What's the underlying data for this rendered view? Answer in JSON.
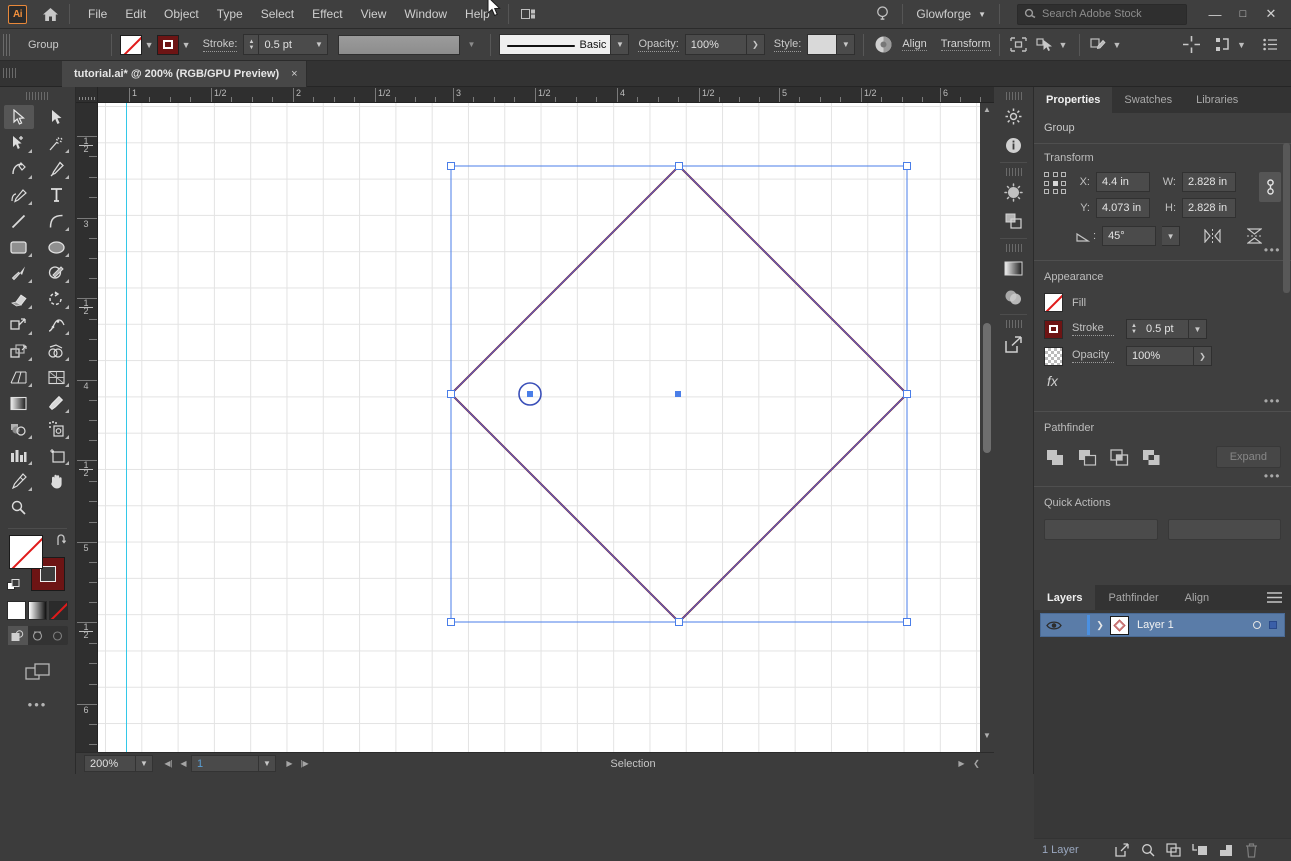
{
  "app": {
    "logo": "Ai",
    "title": "Adobe Illustrator"
  },
  "menubar": {
    "items": [
      "File",
      "Edit",
      "Object",
      "Type",
      "Select",
      "Effect",
      "View",
      "Window",
      "Help"
    ],
    "account": "Glowforge",
    "search_placeholder": "Search Adobe Stock",
    "window_buttons": [
      "minimize",
      "maximize",
      "close"
    ]
  },
  "controlbar": {
    "selection_label": "Group",
    "stroke_label": "Stroke:",
    "stroke_weight": "0.5 pt",
    "brush_label": "Basic",
    "opacity_label": "Opacity:",
    "opacity_value": "100%",
    "style_label": "Style:",
    "align_label": "Align",
    "transform_label": "Transform"
  },
  "tab": {
    "title": "tutorial.ai* @ 200% (RGB/GPU Preview)",
    "close": "×"
  },
  "toolbar": {
    "tools": [
      "selection-tool",
      "direct-selection-tool",
      "magic-wand-tool",
      "lasso-tool",
      "curvature-tool",
      "pen-tool",
      "add-anchor-point-tool",
      "type-tool",
      "line-segment-tool",
      "arc-tool",
      "rectangle-tool",
      "ellipse-tool",
      "paintbrush-tool",
      "shaper-tool",
      "eraser-tool",
      "rotate-tool",
      "scale-tool",
      "width-tool",
      "free-transform-tool",
      "shape-builder-tool",
      "perspective-grid-tool",
      "mesh-tool",
      "gradient-tool",
      "eyedropper-tool",
      "blend-tool",
      "symbol-sprayer-tool",
      "column-graph-tool",
      "artboard-tool",
      "slice-tool",
      "hand-tool",
      "zoom-tool"
    ],
    "active_tool": "selection-tool",
    "fill": "None",
    "stroke": "#6d1414",
    "color_modes": [
      "color",
      "gradient",
      "none"
    ],
    "draw_modes": [
      "draw-normal",
      "draw-behind",
      "draw-inside"
    ],
    "screen_mode": "screen-mode-toggle",
    "more": "•••"
  },
  "rulers": {
    "horizontal": [
      "1",
      "1/2",
      "2",
      "1/2",
      "3",
      "1/2",
      "4",
      "1/2",
      "5",
      "1/2",
      "6"
    ],
    "vertical": [
      "1/2",
      "3",
      "1/2",
      "4",
      "1/2",
      "5",
      "1/2",
      "6"
    ],
    "unit": "in"
  },
  "canvas": {
    "grid": "on",
    "guide_color": "#33c8e8",
    "selection_color": "#4a7ee8",
    "shape": "diamond",
    "stroke_color": "#5a5ab4"
  },
  "statusbar": {
    "zoom": "200%",
    "page": "1",
    "status": "Selection"
  },
  "dock_icons": [
    "properties-icon",
    "info-icon",
    "color-guide-icon",
    "layers-dock-icon",
    "gradient-dock-icon",
    "transparency-dock-icon",
    "export-dock-icon"
  ],
  "properties": {
    "tabs": [
      "Properties",
      "Swatches",
      "Libraries"
    ],
    "active_tab": "Properties",
    "object_type": "Group",
    "transform": {
      "title": "Transform",
      "x_label": "X:",
      "x_value": "4.4 in",
      "y_label": "Y:",
      "y_value": "4.073 in",
      "w_label": "W:",
      "w_value": "2.828 in",
      "h_label": "H:",
      "h_value": "2.828 in",
      "angle_value": "45°",
      "link_icon": "link-proportions-icon",
      "flip_h_icon": "flip-horizontal-icon",
      "flip_v_icon": "flip-vertical-icon",
      "more": "•••"
    },
    "appearance": {
      "title": "Appearance",
      "fill_label": "Fill",
      "stroke_label": "Stroke",
      "stroke_weight": "0.5 pt",
      "opacity_label": "Opacity",
      "opacity_value": "100%",
      "fx_label": "fx",
      "more": "•••"
    },
    "pathfinder": {
      "title": "Pathfinder",
      "buttons": [
        "unite",
        "minus-front",
        "intersect",
        "exclude"
      ],
      "expand_label": "Expand",
      "more": "•••"
    },
    "quick_actions": {
      "title": "Quick Actions"
    }
  },
  "layers": {
    "tabs": [
      "Layers",
      "Pathfinder",
      "Align"
    ],
    "active_tab": "Layers",
    "menu_icon": "panel-menu-icon",
    "rows": [
      {
        "name": "Layer 1",
        "visible": true,
        "selected": true
      }
    ],
    "footer": {
      "count": "1 Layer",
      "icons": [
        "locate-object-icon",
        "search-icon",
        "make-clipping-mask-icon",
        "create-sublayer-icon",
        "new-layer-icon",
        "delete-layer-icon"
      ]
    }
  }
}
